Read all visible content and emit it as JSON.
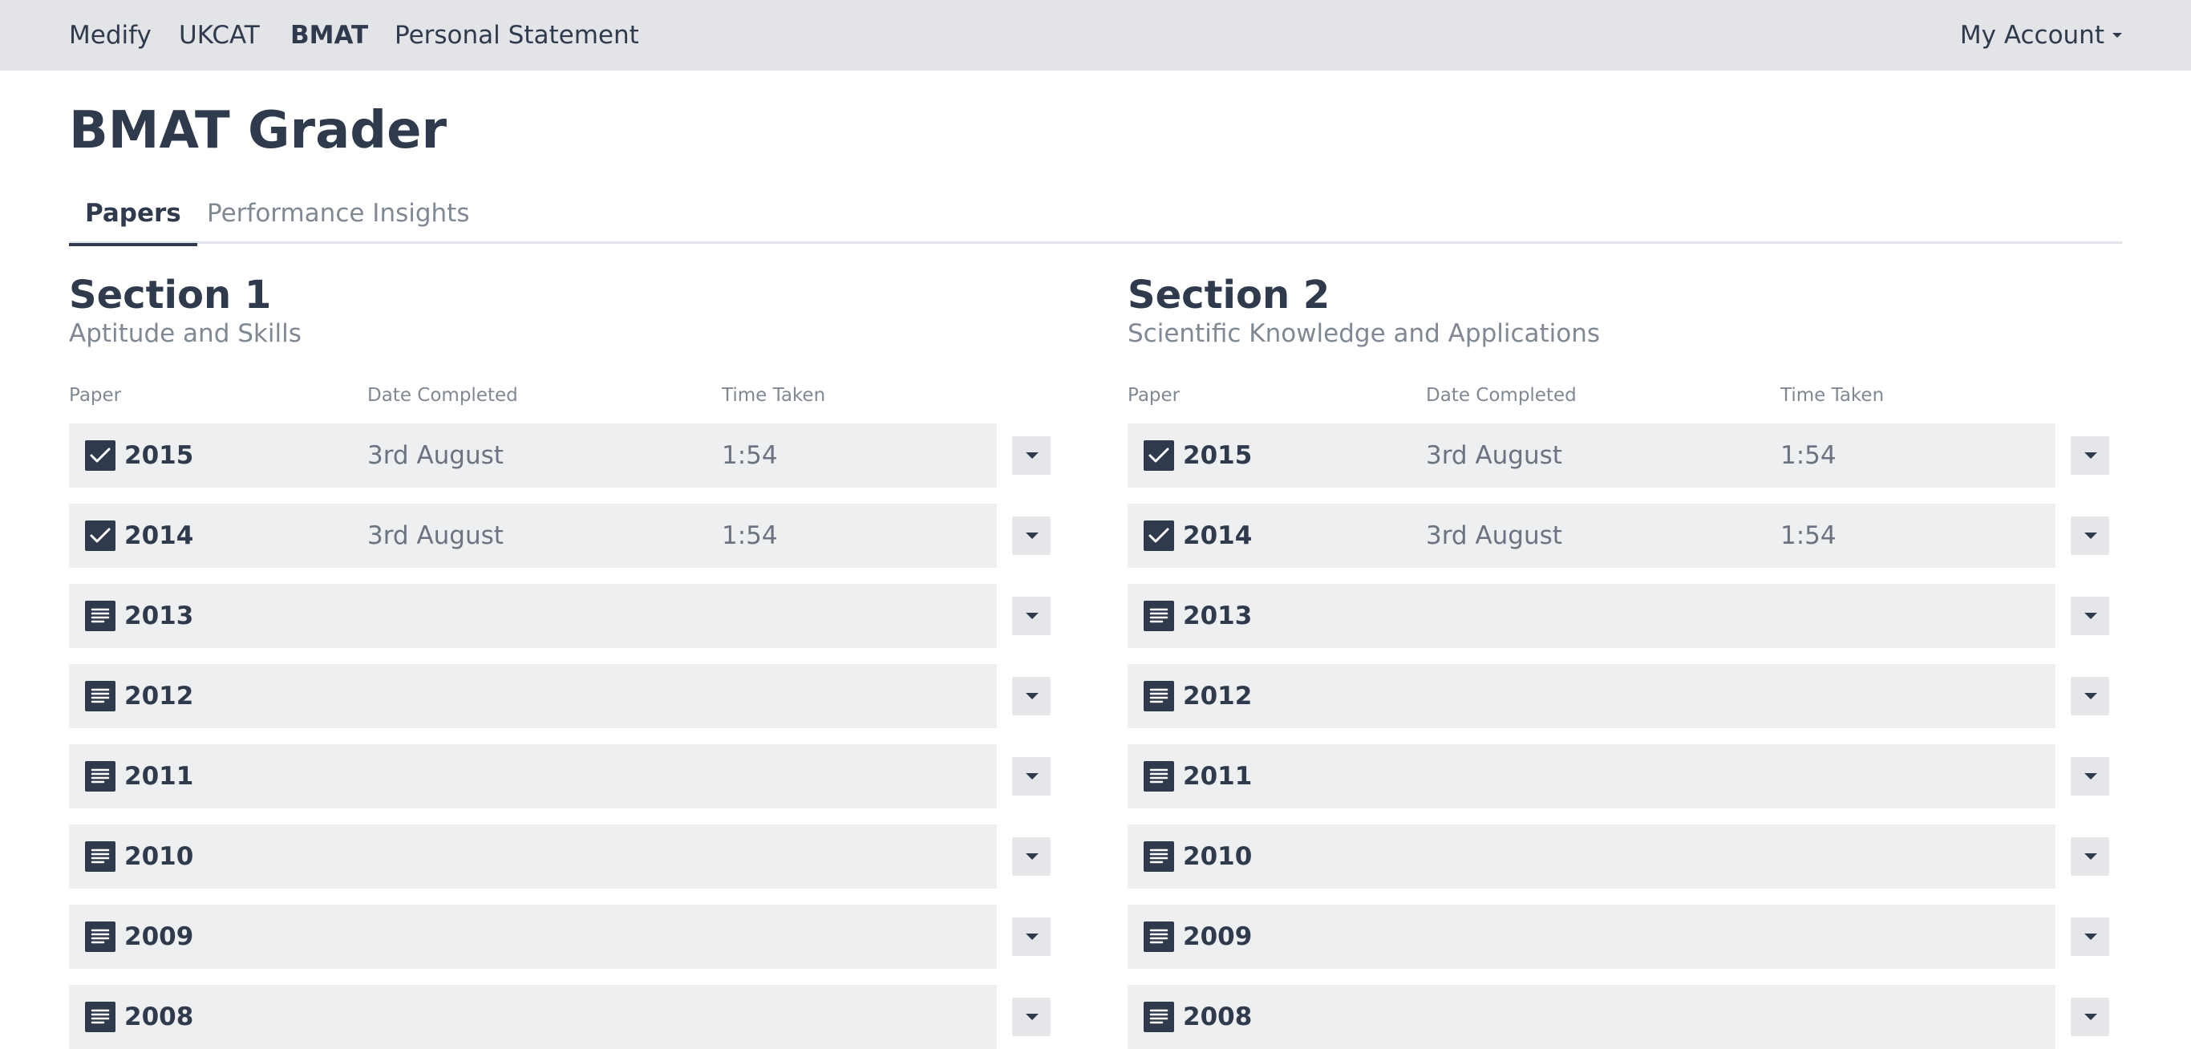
{
  "nav": {
    "brand": "Medify",
    "items": [
      "UKCAT",
      "BMAT",
      "Personal Statement"
    ],
    "active": "BMAT",
    "account": "My Account"
  },
  "page": {
    "title": "BMAT Grader",
    "tabs": [
      {
        "label": "Papers",
        "active": true
      },
      {
        "label": "Performance Insights",
        "active": false
      }
    ]
  },
  "columns": {
    "paper": "Paper",
    "date": "Date Completed",
    "time": "Time Taken"
  },
  "sections": [
    {
      "title": "Section 1",
      "subtitle": "Aptitude and Skills",
      "papers": [
        {
          "year": "2015",
          "status": "completed",
          "date": "3rd August",
          "time": "1:54"
        },
        {
          "year": "2014",
          "status": "completed",
          "date": "3rd August",
          "time": "1:54"
        },
        {
          "year": "2013",
          "status": "not-started",
          "date": "",
          "time": ""
        },
        {
          "year": "2012",
          "status": "not-started",
          "date": "",
          "time": ""
        },
        {
          "year": "2011",
          "status": "not-started",
          "date": "",
          "time": ""
        },
        {
          "year": "2010",
          "status": "not-started",
          "date": "",
          "time": ""
        },
        {
          "year": "2009",
          "status": "not-started",
          "date": "",
          "time": ""
        },
        {
          "year": "2008",
          "status": "not-started",
          "date": "",
          "time": ""
        }
      ]
    },
    {
      "title": "Section 2",
      "subtitle": "Scientific Knowledge and Applications",
      "papers": [
        {
          "year": "2015",
          "status": "completed",
          "date": "3rd August",
          "time": "1:54"
        },
        {
          "year": "2014",
          "status": "completed",
          "date": "3rd August",
          "time": "1:54"
        },
        {
          "year": "2013",
          "status": "not-started",
          "date": "",
          "time": ""
        },
        {
          "year": "2012",
          "status": "not-started",
          "date": "",
          "time": ""
        },
        {
          "year": "2011",
          "status": "not-started",
          "date": "",
          "time": ""
        },
        {
          "year": "2010",
          "status": "not-started",
          "date": "",
          "time": ""
        },
        {
          "year": "2009",
          "status": "not-started",
          "date": "",
          "time": ""
        },
        {
          "year": "2008",
          "status": "not-started",
          "date": "",
          "time": ""
        }
      ]
    }
  ],
  "icons": {
    "completed": "checkbox-checked-icon",
    "not-started": "document-icon",
    "menu": "chevron-down-icon"
  }
}
